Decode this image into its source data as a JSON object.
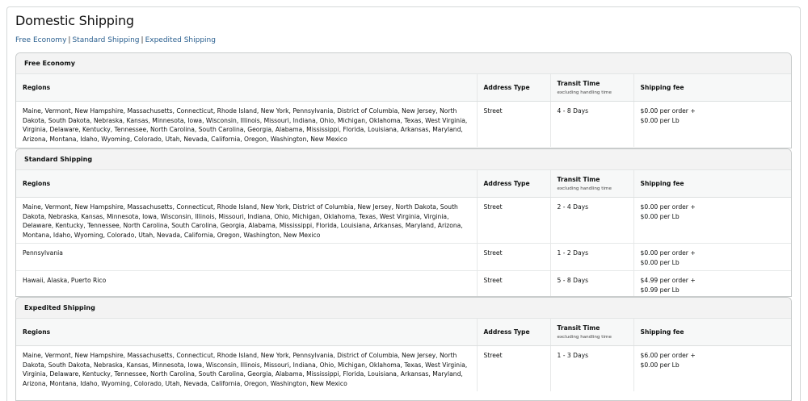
{
  "page": {
    "title": "Domestic Shipping",
    "links": [
      "Free Economy",
      "Standard Shipping",
      "Expedited Shipping"
    ],
    "separator": "|"
  },
  "headers": {
    "regions": "Regions",
    "address_type": "Address Type",
    "transit_time": "Transit Time",
    "transit_sub": "excluding handling time",
    "shipping_fee": "Shipping fee"
  },
  "sections": [
    {
      "title": "Free Economy",
      "rows": [
        {
          "regions": "Maine, Vermont, New Hampshire, Massachusetts, Connecticut, Rhode Island, New York, Pennsylvania, District of Columbia, New Jersey, North Dakota, South Dakota, Nebraska, Kansas, Minnesota, Iowa, Wisconsin, Illinois, Missouri, Indiana, Ohio, Michigan, Oklahoma, Texas, West Virginia, Virginia, Delaware, Kentucky, Tennessee, North Carolina, South Carolina, Georgia, Alabama, Mississippi, Florida, Louisiana, Arkansas, Maryland, Arizona, Montana, Idaho, Wyoming, Colorado, Utah, Nevada, California, Oregon, Washington, New Mexico",
          "address_type": "Street",
          "transit": "4 - 8 Days",
          "fee_order": "$0.00 per order +",
          "fee_lb": "$0.00 per Lb"
        }
      ]
    },
    {
      "title": "Standard Shipping",
      "rows": [
        {
          "regions": "Maine, Vermont, New Hampshire, Massachusetts, Connecticut, Rhode Island, New York, District of Columbia, New Jersey, North Dakota, South Dakota, Nebraska, Kansas, Minnesota, Iowa, Wisconsin, Illinois, Missouri, Indiana, Ohio, Michigan, Oklahoma, Texas, West Virginia, Virginia, Delaware, Kentucky, Tennessee, North Carolina, South Carolina, Georgia, Alabama, Mississippi, Florida, Louisiana, Arkansas, Maryland, Arizona, Montana, Idaho, Wyoming, Colorado, Utah, Nevada, California, Oregon, Washington, New Mexico",
          "address_type": "Street",
          "transit": "2 - 4 Days",
          "fee_order": "$0.00 per order +",
          "fee_lb": "$0.00 per Lb"
        },
        {
          "regions": "Pennsylvania",
          "address_type": "Street",
          "transit": "1 - 2 Days",
          "fee_order": "$0.00 per order +",
          "fee_lb": "$0.00 per Lb"
        },
        {
          "regions": "Hawaii, Alaska, Puerto Rico",
          "address_type": "Street",
          "transit": "5 - 8 Days",
          "fee_order": "$4.99 per order +",
          "fee_lb": "$0.99 per Lb"
        }
      ]
    },
    {
      "title": "Expedited Shipping",
      "rows": [
        {
          "regions": "Maine, Vermont, New Hampshire, Massachusetts, Connecticut, Rhode Island, New York, Pennsylvania, District of Columbia, New Jersey, North Dakota, South Dakota, Nebraska, Kansas, Minnesota, Iowa, Wisconsin, Illinois, Missouri, Indiana, Ohio, Michigan, Oklahoma, Texas, West Virginia, Virginia, Delaware, Kentucky, Tennessee, North Carolina, South Carolina, Georgia, Alabama, Mississippi, Florida, Louisiana, Arkansas, Maryland, Arizona, Montana, Idaho, Wyoming, Colorado, Utah, Nevada, California, Oregon, Washington, New Mexico",
          "address_type": "Street",
          "transit": "1 - 3 Days",
          "fee_order": "$6.00 per order +",
          "fee_lb": "$0.00 per Lb"
        }
      ]
    }
  ]
}
